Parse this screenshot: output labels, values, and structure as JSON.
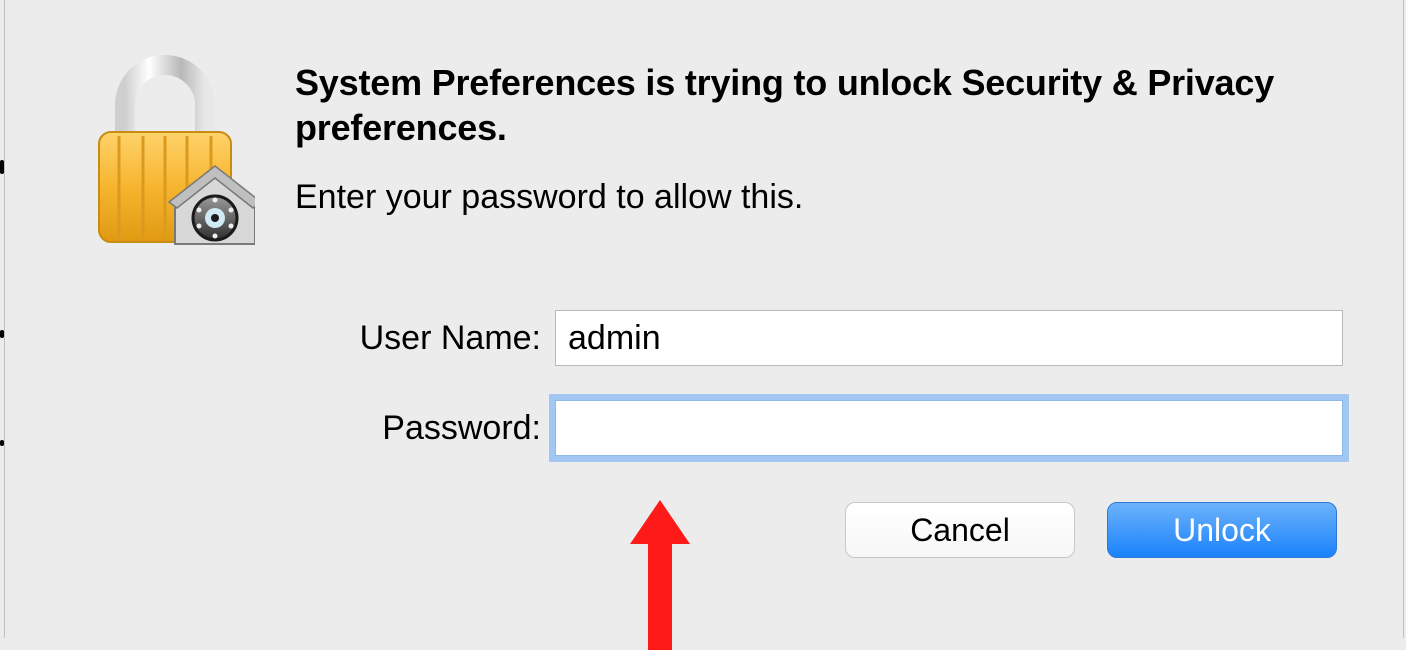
{
  "dialog": {
    "title": "System Preferences is trying to unlock Security & Privacy preferences.",
    "subtitle": "Enter your password to allow this.",
    "username_label": "User Name:",
    "username_value": "admin",
    "password_label": "Password:",
    "password_value": "",
    "cancel_label": "Cancel",
    "unlock_label": "Unlock"
  },
  "icons": {
    "lock": "lock-icon"
  }
}
